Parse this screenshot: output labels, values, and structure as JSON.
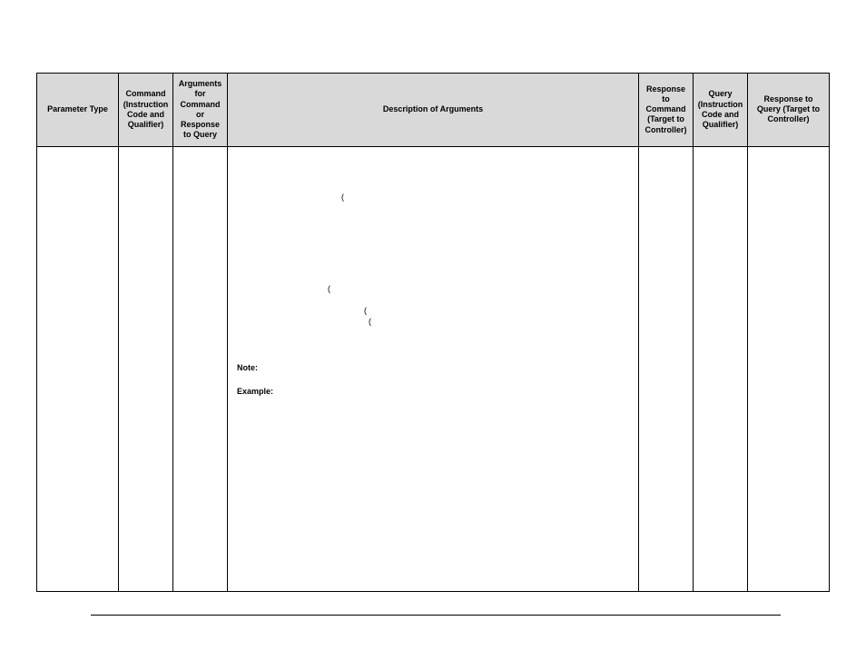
{
  "table": {
    "headers": {
      "param_type": "Parameter Type",
      "command": "Command (Instruction Code and Qualifier)",
      "arguments": "Arguments for Command or Response to Query",
      "description": "Description of Arguments",
      "response_command": "Response to Command (Target to Controller)",
      "query": "Query (Instruction Code and Qualifier)",
      "response_query": "Response to Query (Target to Controller)"
    },
    "body": {
      "parens": {
        "p1": "(",
        "p2": "(",
        "p3": "(",
        "p4": "("
      },
      "labels": {
        "note": "Note:",
        "example": "Example:"
      }
    }
  }
}
